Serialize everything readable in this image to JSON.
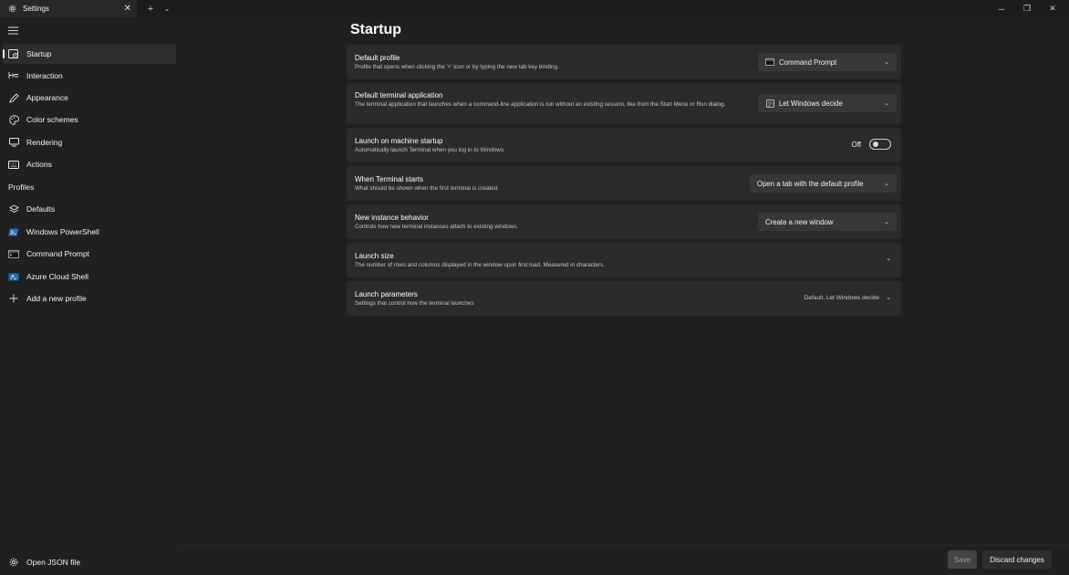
{
  "tab": {
    "title": "Settings"
  },
  "sidebar": {
    "items": [
      {
        "label": "Startup",
        "icon": "startup-icon"
      },
      {
        "label": "Interaction",
        "icon": "interaction-icon"
      },
      {
        "label": "Appearance",
        "icon": "pen-icon"
      },
      {
        "label": "Color schemes",
        "icon": "palette-icon"
      },
      {
        "label": "Rendering",
        "icon": "monitor-icon"
      },
      {
        "label": "Actions",
        "icon": "keyboard-icon"
      }
    ],
    "profiles_header": "Profiles",
    "profiles": [
      {
        "label": "Defaults",
        "icon": "layers-icon"
      },
      {
        "label": "Windows PowerShell",
        "icon": "powershell-icon"
      },
      {
        "label": "Command Prompt",
        "icon": "cmd-icon"
      },
      {
        "label": "Azure Cloud Shell",
        "icon": "azure-icon"
      },
      {
        "label": "Add a new profile",
        "icon": "plus-icon"
      }
    ],
    "open_json": "Open JSON file"
  },
  "page": {
    "title": "Startup"
  },
  "settings": {
    "default_profile": {
      "title": "Default profile",
      "desc": "Profile that opens when clicking the '+' icon or by typing the new tab key binding.",
      "value": "Command Prompt"
    },
    "default_terminal": {
      "title": "Default terminal application",
      "desc": "The terminal application that launches when a command-line application is run without an existing session, like from the Start Menu or Run dialog.",
      "value": "Let Windows decide"
    },
    "launch_startup": {
      "title": "Launch on machine startup",
      "desc": "Automatically launch Terminal when you log in to Windows.",
      "state": "Off"
    },
    "when_starts": {
      "title": "When Terminal starts",
      "desc": "What should be shown when the first terminal is created.",
      "value": "Open a tab with the default profile"
    },
    "new_instance": {
      "title": "New instance behavior",
      "desc": "Controls how new terminal instances attach to existing windows.",
      "value": "Create a new window"
    },
    "launch_size": {
      "title": "Launch size",
      "desc": "The number of rows and columns displayed in the window upon first load. Measured in characters."
    },
    "launch_params": {
      "title": "Launch parameters",
      "desc": "Settings that control how the terminal launches",
      "summary": "Default, Let Windows decide"
    }
  },
  "footer": {
    "save": "Save",
    "discard": "Discard changes"
  },
  "colors": {
    "background": "#202020",
    "card": "#2b2b2b",
    "control": "#373737",
    "accent_text": "#ffffff"
  }
}
